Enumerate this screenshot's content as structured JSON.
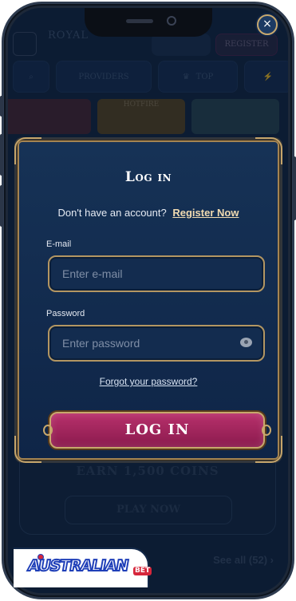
{
  "background": {
    "logo": "ROYAL",
    "register_label": "REGISTER",
    "nav_chips": [
      "PROVIDERS",
      "TOP"
    ],
    "game_label": "HOTFIRE",
    "promo_text": "EARN 1,500 COINS",
    "play_now_label": "PLAY NOW",
    "see_all_label": "See all (52)"
  },
  "modal": {
    "title": "Log in",
    "close_icon": "×",
    "register_prompt": "Don't have an account?",
    "register_link": "Register Now",
    "email": {
      "label": "E-mail",
      "placeholder": "Enter e-mail",
      "value": ""
    },
    "password": {
      "label": "Password",
      "placeholder": "Enter password",
      "value": ""
    },
    "forgot_link": "Forgot your password?",
    "submit_label": "LOG IN"
  },
  "watermark": {
    "text": "AUSTRALIAN",
    "suffix": "BET"
  },
  "colors": {
    "accent_gold": "#b39662",
    "button_pink": "#a22761",
    "modal_bg": "#132c4f"
  }
}
